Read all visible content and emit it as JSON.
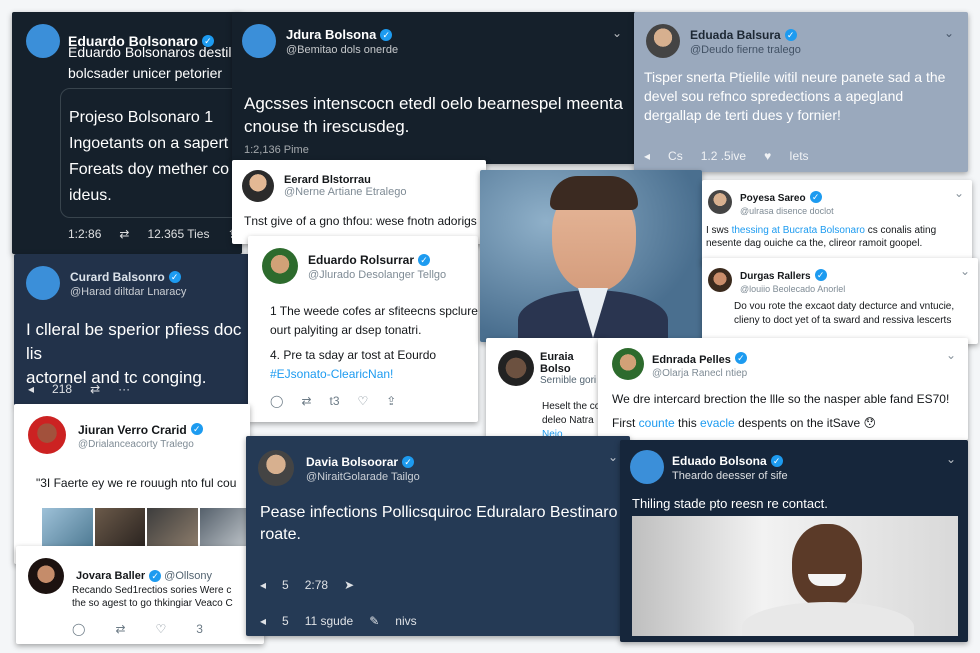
{
  "c1": {
    "name": "Eduardo Bolsonaro",
    "lines": [
      "Eduardo Bolsonaros destil",
      "bolcsader unicer petorier"
    ],
    "quote": [
      "Projeso Bolsonaro 1",
      "Ingoetants on a sapert",
      "Foreats doy mether co",
      "ideus."
    ],
    "time": "1:2:86",
    "count": "12.365 Ties"
  },
  "c2": {
    "name": "Jdura Bolsona",
    "handle": "@Bemitao dols onerde",
    "text": [
      "Agcsses intenscocn etedl oelo bearnespel meenta",
      "cnouse th irescusdeg."
    ],
    "meta": "1:2,136 Pime"
  },
  "c3": {
    "name": "Eduada Balsura",
    "handle": "@Deudo fierne tralego",
    "text": [
      "Tisper snerta Ptielile witil neure panete sad a the",
      "devel sou refnco spredections a apegland",
      "dergallap de terti dues y fornier!"
    ],
    "act1": "Cs",
    "act2": "1.2 .5ive",
    "act3": "Iets"
  },
  "c4": {
    "name": "Eerard Blstorrau",
    "handle": "@Nerne Artiane Etralego",
    "text": "Tnst give of a gno thfou: wese fnotn adorigs t"
  },
  "c5": {
    "name": "Eduardo Rolsurrar",
    "handle": "@Jlurado Desolanger Tellgo",
    "line1": "1 The weede cofes ar sfiteecns spclure",
    "line2": "ourt palyiting ar dsep tonatri.",
    "line3": "4. Pre ta sday ar tost at Eourdo",
    "tag": "#EJsonato-ClearicNan!",
    "a2": "t3"
  },
  "c6": {
    "name": "Poyesa Sareo",
    "handle": "@ulrasa disence doclot",
    "text_a": "I sws ",
    "text_link": "thessing at Bucrata Bolsonaro",
    "text_b": " cs conalis ating",
    "text2": "nesente dag ouiche ca the, clireor ramoit goopel."
  },
  "c7": {
    "name": "Durgas Rallers",
    "handle": "@louiio Beolecado Anorlel",
    "text": [
      "Do vou rote the excaot daty decturce and vntucie,",
      "clieny to doct yet of ta sward and ressiva lescerts"
    ]
  },
  "c8": {
    "name": "Curard Balsonro",
    "handle": "@Harad diltdar Lnaracy",
    "text": [
      "I clleral be sperior pfiess doc lis",
      "actornel and tc conging."
    ],
    "a2": "218"
  },
  "c9": {
    "name": "Euraia Bolso",
    "handle": "Sernible gori",
    "text": [
      "Heselt the co",
      "deleo Natra"
    ],
    "link": "Neio"
  },
  "c10": {
    "name": "Ednrada Pelles",
    "handle": "@Olarja Ranecl ntiep",
    "text": "We dre intercard brection the llle so the nasper able fand ES70!",
    "t2a": "First ",
    "t2link": "counte",
    "t2b": " this ",
    "t2link2": "evacle",
    "t2c": " despents on the itSave"
  },
  "c11": {
    "name": "Jiuran Verro Crarid",
    "handle": "@Drialanceacorty Tralego",
    "text": "\"3I Faerte ey we re rouugh nto ful cou"
  },
  "c12": {
    "name": "Davia Bolsoorar",
    "handle": "@NiraitGolarade Tailgo",
    "text": [
      "Pease infections Pollicsquiroc Eduralaro Bestinaro",
      "roate."
    ],
    "a1": "5",
    "a2": "2:78",
    "b1": "5",
    "b2": "11 sgude",
    "b3": "nivs"
  },
  "c13": {
    "name": "Eduado Bolsona",
    "handle": "Theardo deesser of sife",
    "text": "Thiling stade pto reesn re contact."
  },
  "c14": {
    "name": "Jovara Baller",
    "handle": "@Ollsony",
    "text": [
      "Recando Sed1rectios sories Were c",
      "the so agest to go thkingiar Veaco C"
    ],
    "a3": "3"
  }
}
